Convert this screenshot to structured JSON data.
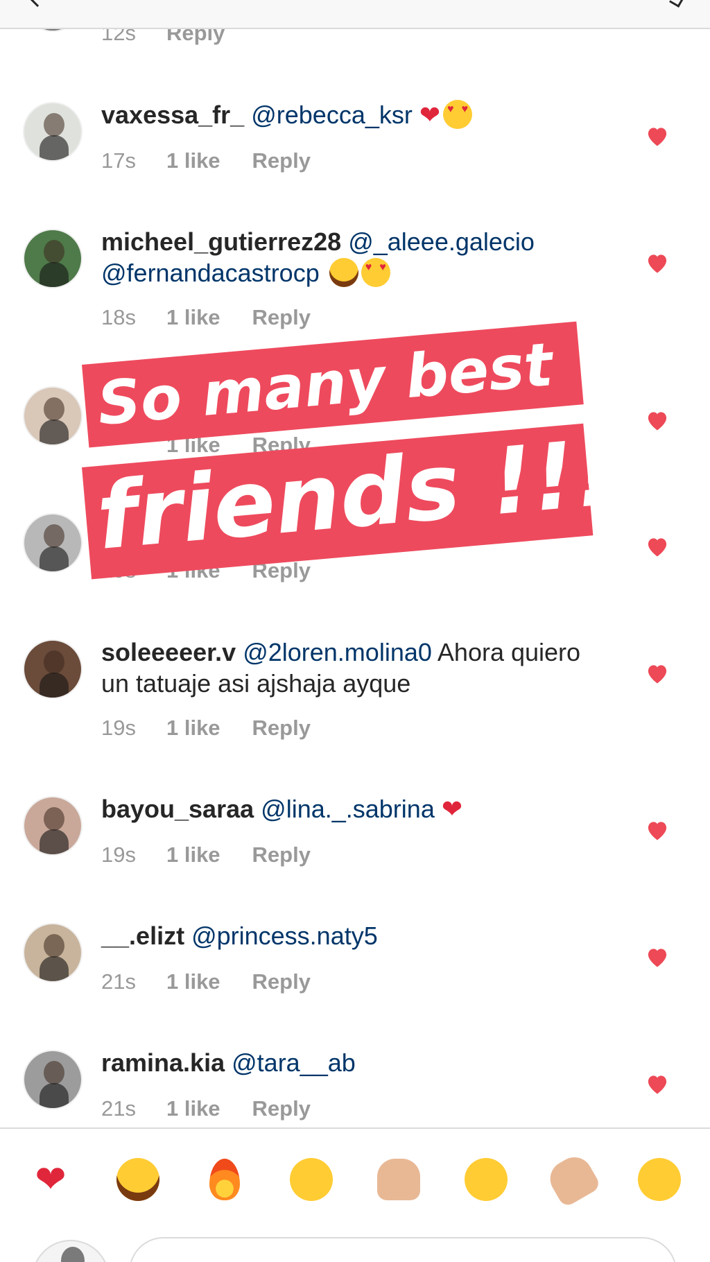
{
  "colors": {
    "heart": "#ed4956",
    "mention": "#003569",
    "meta": "#999999",
    "sticker_bg": "#ee4a5d"
  },
  "top_comment": {
    "time": "12s",
    "reply": "Reply"
  },
  "comments": [
    {
      "username": "vaxessa_fr_",
      "text": "@rebecca_ksr",
      "time": "17s",
      "likes": "1 like",
      "reply": "Reply"
    },
    {
      "username": "micheel_gutierrez28",
      "text": "@_aleee.galecio @fernandacastrocp",
      "time": "18s",
      "likes": "1 like",
      "reply": "Reply"
    },
    {
      "username": "",
      "text": "",
      "time": "",
      "likes": "1 like",
      "reply": "Reply"
    },
    {
      "username": "",
      "text": "",
      "time": "19s",
      "likes": "1 like",
      "reply": "Reply"
    },
    {
      "username": "soleeeeer.v",
      "text": "@2loren.molina0",
      "plain": "Ahora quiero un tatuaje asi ajshaja ayque",
      "time": "19s",
      "likes": "1 like",
      "reply": "Reply"
    },
    {
      "username": "bayou_saraa",
      "text": "@lina._.sabrina",
      "time": "19s",
      "likes": "1 like",
      "reply": "Reply"
    },
    {
      "username": "__.elizt",
      "text": "@princess.naty5",
      "time": "21s",
      "likes": "1 like",
      "reply": "Reply"
    },
    {
      "username": "ramina.kia",
      "text": "@tara__ab",
      "time": "21s",
      "likes": "1 like",
      "reply": "Reply"
    }
  ],
  "sticker": {
    "line1": "So many best",
    "line2": "friends !!!"
  },
  "emoji_bar": [
    {
      "icon": "red-heart-emoji",
      "glyph": "❤"
    },
    {
      "icon": "tears-of-joy-emoji"
    },
    {
      "icon": "fire-emoji"
    },
    {
      "icon": "kissing-face-emoji"
    },
    {
      "icon": "raising-hands-emoji"
    },
    {
      "icon": "heart-eyes-emoji"
    },
    {
      "icon": "clapping-hands-emoji"
    },
    {
      "icon": "smirking-face-emoji"
    }
  ]
}
